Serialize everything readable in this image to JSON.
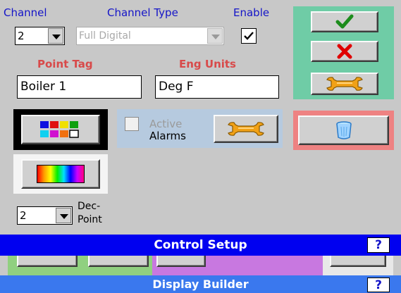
{
  "header": {
    "channel_label": "Channel",
    "channel_type_label": "Channel Type",
    "enable_label": "Enable"
  },
  "channel": {
    "value": "2"
  },
  "channel_type": {
    "value": "Full Digital",
    "disabled": true
  },
  "enable": {
    "checked": true
  },
  "point_tag": {
    "label": "Point Tag",
    "value": "Boiler 1"
  },
  "eng_units": {
    "label": "Eng Units",
    "value": "Deg F"
  },
  "alarms": {
    "active_label": "Active",
    "alarms_label": "Alarms",
    "checked": false
  },
  "decimal": {
    "value": "2",
    "label_line1": "Dec-",
    "label_line2": "Point"
  },
  "control_setup": {
    "title": "Control Setup",
    "help": "?"
  },
  "display_builder": {
    "title": "Display Builder",
    "help": "?"
  },
  "icons": {
    "ok": "checkmark-icon",
    "cancel": "x-icon",
    "settings": "wrench-icon",
    "delete": "trash-can-icon",
    "palette": "color-palette-icon",
    "gradient": "rainbow-gradient-icon",
    "alarm_settings": "wrench-icon"
  },
  "colors": {
    "control_bar": "#0000f0",
    "display_bar": "#3a78ee",
    "action_panel": "#6fcca6",
    "delete_panel": "#ee8282",
    "alarm_panel": "#b6cadf",
    "label_blue": "#1515c8",
    "label_red": "#d84a4a"
  }
}
